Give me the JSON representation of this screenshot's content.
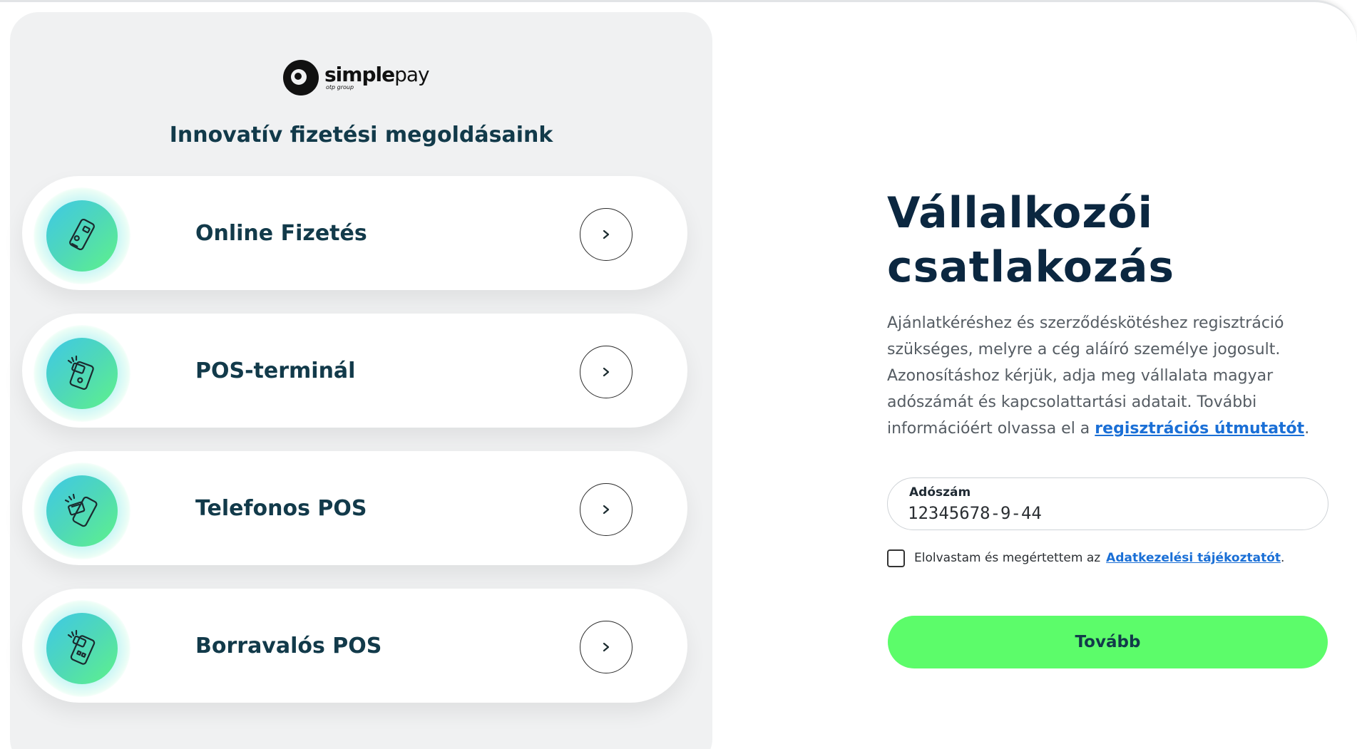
{
  "brand": {
    "logo_word_bold": "simple",
    "logo_word_light": "pay",
    "logo_sub": "otp group"
  },
  "left_panel": {
    "title": "Innovatív fizetési megoldásaink",
    "cards": [
      {
        "label": "Online Fizetés",
        "icon": "phone-payment-icon"
      },
      {
        "label": "POS-terminál",
        "icon": "pos-terminal-icon"
      },
      {
        "label": "Telefonos POS",
        "icon": "phone-pos-icon"
      },
      {
        "label": "Borravalós POS",
        "icon": "tip-pos-icon"
      }
    ]
  },
  "form": {
    "title_line1": "Vállalkozói",
    "title_line2": "csatlakozás",
    "description": "Ajánlatkéréshez és szerződéskötéshez regisztráció szükséges, melyre a cég aláíró személye jogosult. Azonosításhoz kérjük, adja meg vállalata magyar adószámát és kapcsolattartási adatait. További információért olvassa el a ",
    "description_link": "regisztrációs útmutatót",
    "description_end": ".",
    "tax_label": "Adószám",
    "tax_value": "12345678-9-44",
    "consent_text": "Elolvastam és megértettem az",
    "consent_link": "Adatkezelési tájékoztatót",
    "consent_end": ".",
    "submit_label": "Tovább"
  },
  "colors": {
    "accent_green": "#5cfc6a",
    "heading_navy": "#0b2740",
    "link_blue": "#1a6fd6"
  }
}
